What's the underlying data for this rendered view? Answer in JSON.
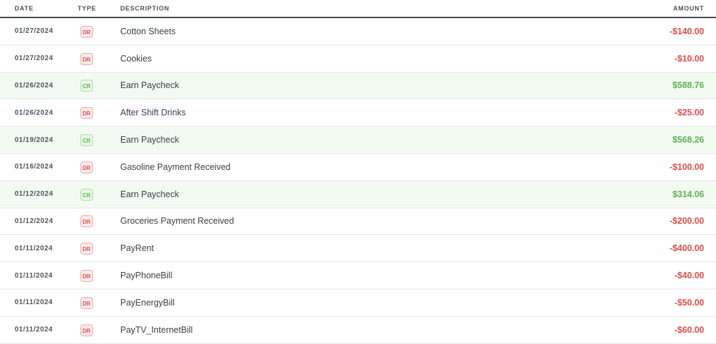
{
  "table": {
    "columns": {
      "date": "DATE",
      "type": "TYPE",
      "description": "DESCRIPTION",
      "amount": "AMOUNT"
    },
    "rows": [
      {
        "date": "01/27/2024",
        "type": "DR",
        "description": "Cotton Sheets",
        "amount": "-$140.00"
      },
      {
        "date": "01/27/2024",
        "type": "DR",
        "description": "Cookies",
        "amount": "-$10.00"
      },
      {
        "date": "01/26/2024",
        "type": "CR",
        "description": "Earn Paycheck",
        "amount": "$588.76"
      },
      {
        "date": "01/26/2024",
        "type": "DR",
        "description": "After Shift Drinks",
        "amount": "-$25.00"
      },
      {
        "date": "01/19/2024",
        "type": "CR",
        "description": "Earn Paycheck",
        "amount": "$568.26"
      },
      {
        "date": "01/16/2024",
        "type": "DR",
        "description": "Gasoline Payment Received",
        "amount": "-$100.00"
      },
      {
        "date": "01/12/2024",
        "type": "CR",
        "description": "Earn Paycheck",
        "amount": "$314.06"
      },
      {
        "date": "01/12/2024",
        "type": "DR",
        "description": "Groceries Payment Received",
        "amount": "-$200.00"
      },
      {
        "date": "01/11/2024",
        "type": "DR",
        "description": "PayRent",
        "amount": "-$400.00"
      },
      {
        "date": "01/11/2024",
        "type": "DR",
        "description": "PayPhoneBill",
        "amount": "-$40.00"
      },
      {
        "date": "01/11/2024",
        "type": "DR",
        "description": "PayEnergyBill",
        "amount": "-$50.00"
      },
      {
        "date": "01/11/2024",
        "type": "DR",
        "description": "PayTV_InternetBill",
        "amount": "-$60.00"
      }
    ]
  },
  "colors": {
    "debit": "#e04c48",
    "credit": "#5bb450",
    "credit_row_bg": "#f3faf1"
  }
}
